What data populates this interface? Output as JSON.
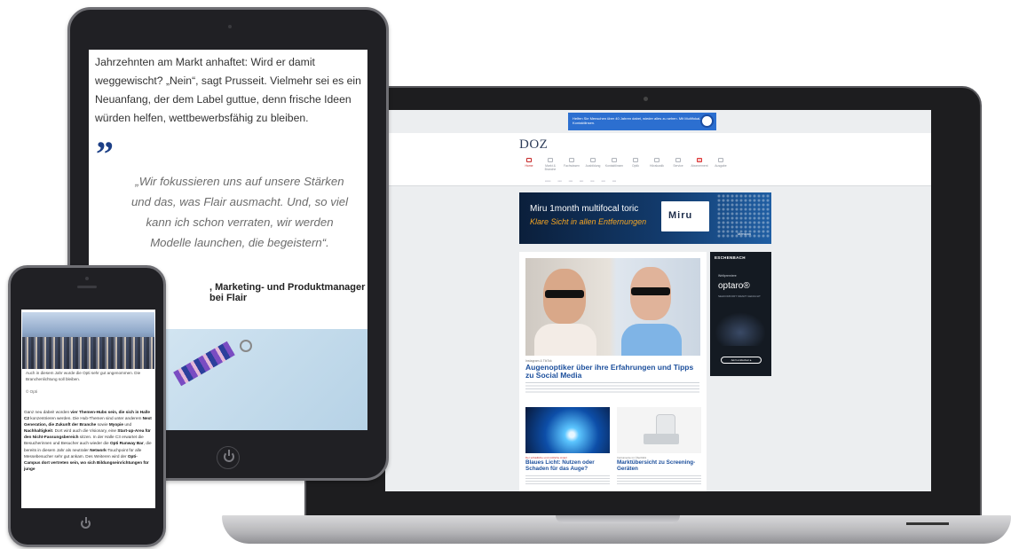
{
  "laptop": {
    "ad_top_text": "Helfen Sie Menschen über 40 Jahren dabei, wieder alles zu sehen. Mit Multifokal-Kontaktlinsen.",
    "site_logo": "DOZ",
    "nav": [
      "Home",
      "Markt & Branche",
      "Fachwissen",
      "Ausbildung",
      "Kontaktlinsen",
      "Optik",
      "Hörakustik",
      "Service",
      "Abonnement",
      "Ausgabe"
    ],
    "banner": {
      "title": "Miru 1month multifocal toric",
      "subtitle": "Klare Sicht in allen Entfernungen",
      "box_label": "Miru",
      "brand": "Menicon"
    },
    "main_article": {
      "kicker": "Instagram & TikTok",
      "headline": "Augenoptiker über ihre Erfahrungen und Tipps zu Social Media"
    },
    "sub_articles": [
      {
        "kicker": "Der schädliche und nützliche Anteil",
        "headline": "Blaues Licht: Nutzen oder Schaden für das Auge?"
      },
      {
        "kicker": "Instrumente im Überblick",
        "headline": "Marktübersicht zu Screening-Geräten"
      }
    ],
    "side_ad": {
      "brand": "ESCHENBACH",
      "small": "Weltpremiere",
      "product": "optaro®",
      "tagline": "SEHKOMFORT SMART GEDACHT",
      "button": "Jetzt entdecken ▸"
    }
  },
  "tablet": {
    "paragraph": "Jahrzehnten am Markt anhaftet: Wird er damit weggewischt? „Nein“, sagt Prusseit. Vielmehr sei es ein Neuanfang, der dem Label guttue, denn frische Ideen würden helfen, wettbewerbsfähig zu bleiben.",
    "quote_mark": "”",
    "quote": "„Wir fokussieren uns auf unsere Stärken und das, was Flair ausmacht. Und, so viel kann ich schon verraten, wir werden Modelle launchen, die begeistern“.",
    "credit": ", Marketing- und Produktmanager bei Flair"
  },
  "phone": {
    "caption": "Auch in diesem Jahr wurde die Opti sehr gut angenommen. Die Branchenlichtung soll bleiben.",
    "credit": "© Opti",
    "body_html_parts": [
      "Ganz neu dabei! worden ",
      "vier Themen-Hubs sein, die sich in Halle C2",
      " konzentrieren werden. Die Hub-Themen sind unter anderem ",
      "Next Generation, die Zukunft der Branche",
      " sowie ",
      "Myopie",
      " und ",
      "Nachhaltigkeit",
      ". Dort wird auch die Visionary, eine ",
      "Start-up-Area für den Nicht-Fassungsbereich",
      " sitzen. In der Halle C3 erwartet die Besucherinnen und Besucher auch wieder die ",
      "Opti Runway Bar",
      ", die bereits in diesem Jahr als neutraler ",
      "Network",
      "-Touchpoint für alle Messebesucher sehr gut ankam. Des Weiteren wird der ",
      "Opti-Campus dort vertreten sein, wo sich Bildungseinrichtungen für junge"
    ]
  }
}
